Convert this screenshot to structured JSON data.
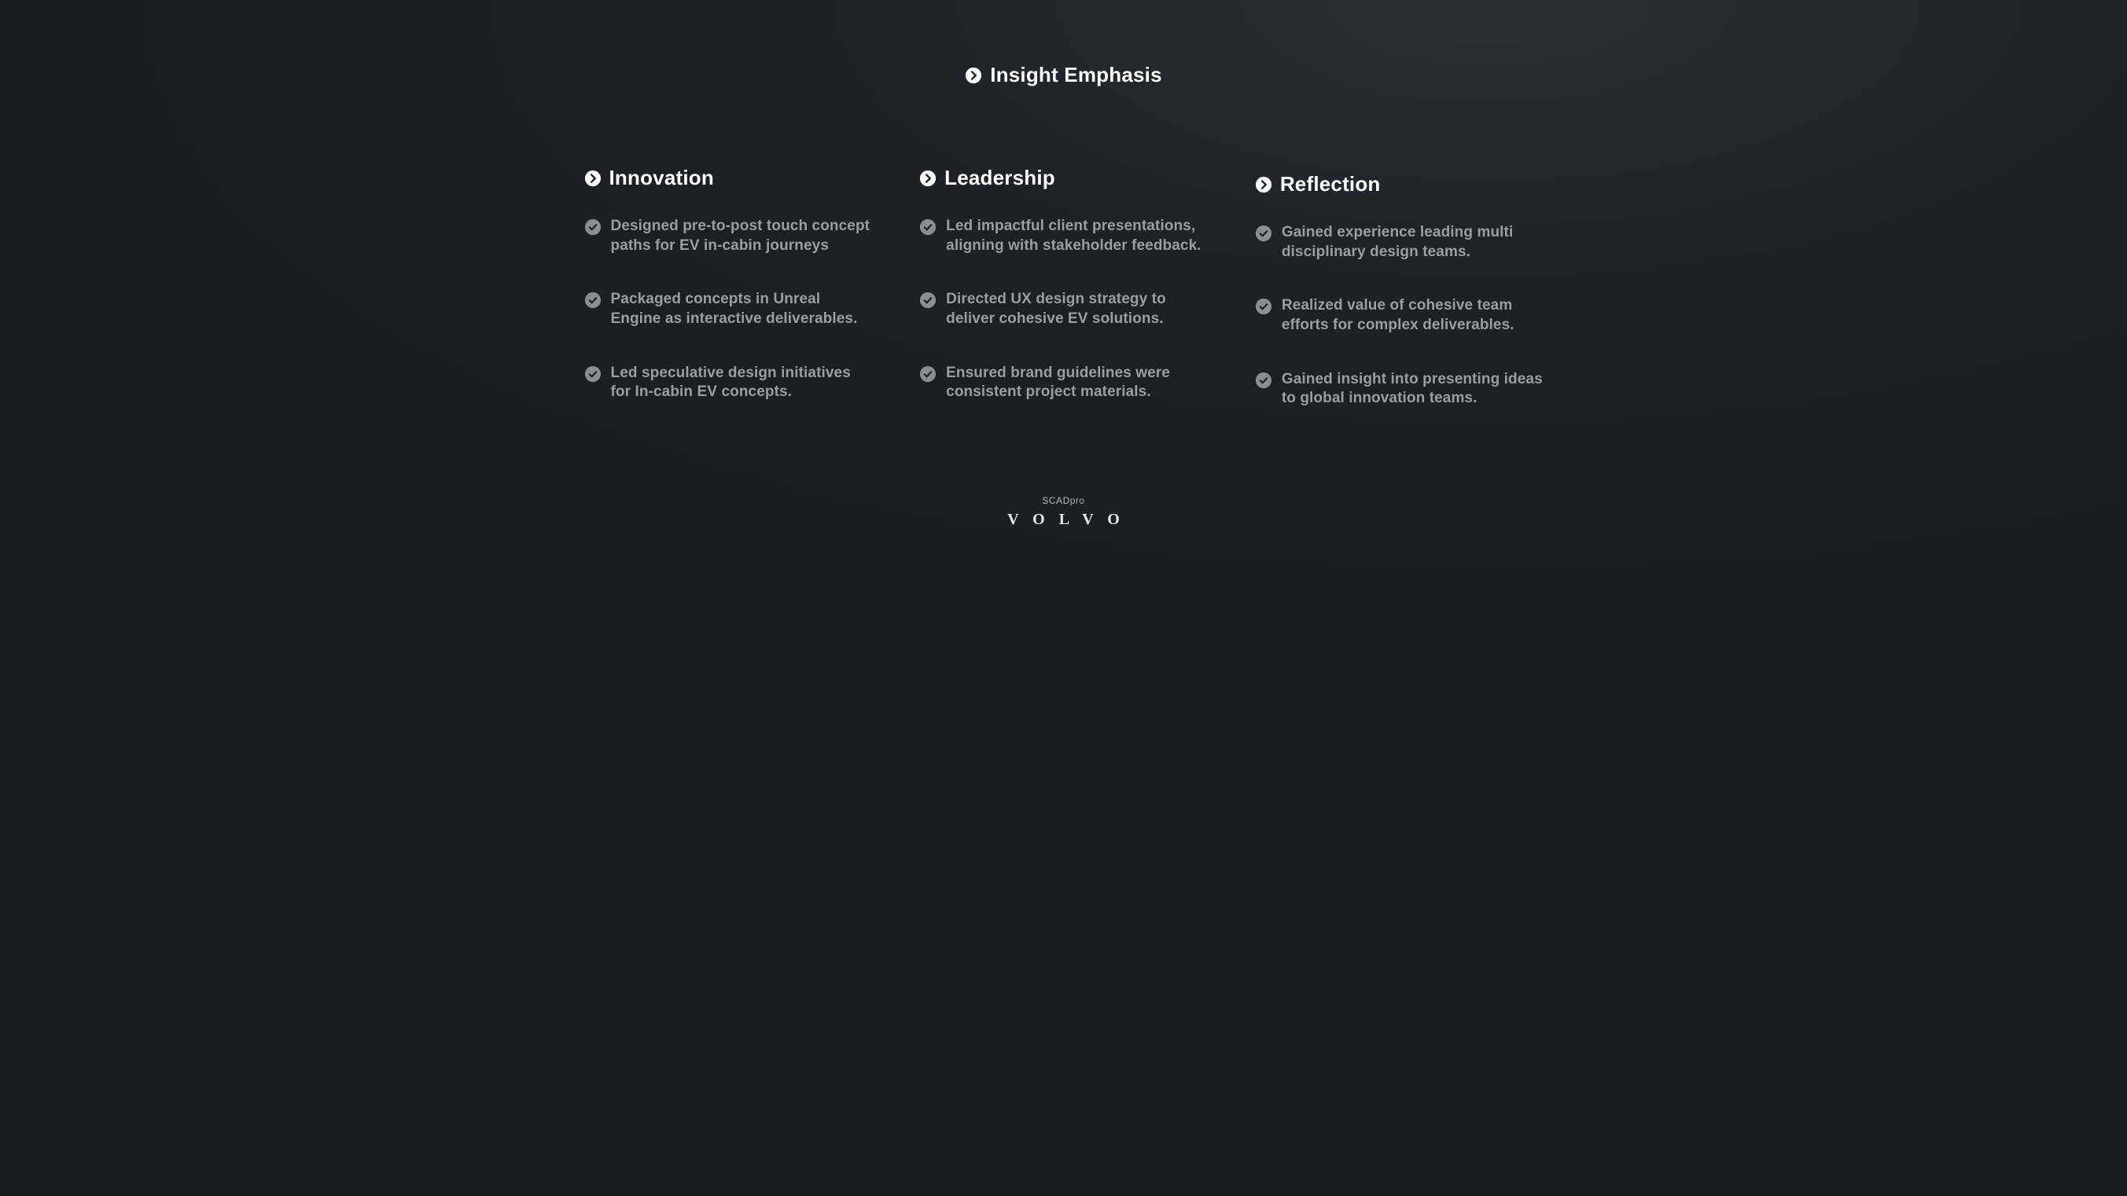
{
  "heading": {
    "title": "Insight Emphasis"
  },
  "columns": [
    {
      "title": "Innovation",
      "offset": false,
      "items": [
        "Designed pre-to-post touch concept paths for EV in-cabin journeys",
        "Packaged concepts in Unreal Engine as interactive deliverables.",
        "Led speculative design initiatives for In-cabin EV concepts."
      ]
    },
    {
      "title": "Leadership",
      "offset": false,
      "items": [
        "Led impactful client presentations, aligning with stakeholder feedback.",
        "Directed UX design strategy to deliver cohesive EV solutions.",
        "Ensured brand guidelines were consistent project materials."
      ]
    },
    {
      "title": "Reflection",
      "offset": true,
      "items": [
        "Gained experience leading multi disciplinary design teams.",
        "Realized value of cohesive team efforts for complex deliverables.",
        "Gained insight into presenting ideas to global innovation teams."
      ]
    }
  ],
  "footer": {
    "brand_small_1": "SCAD",
    "brand_small_2": "pro",
    "brand_large": "VOLVO"
  }
}
